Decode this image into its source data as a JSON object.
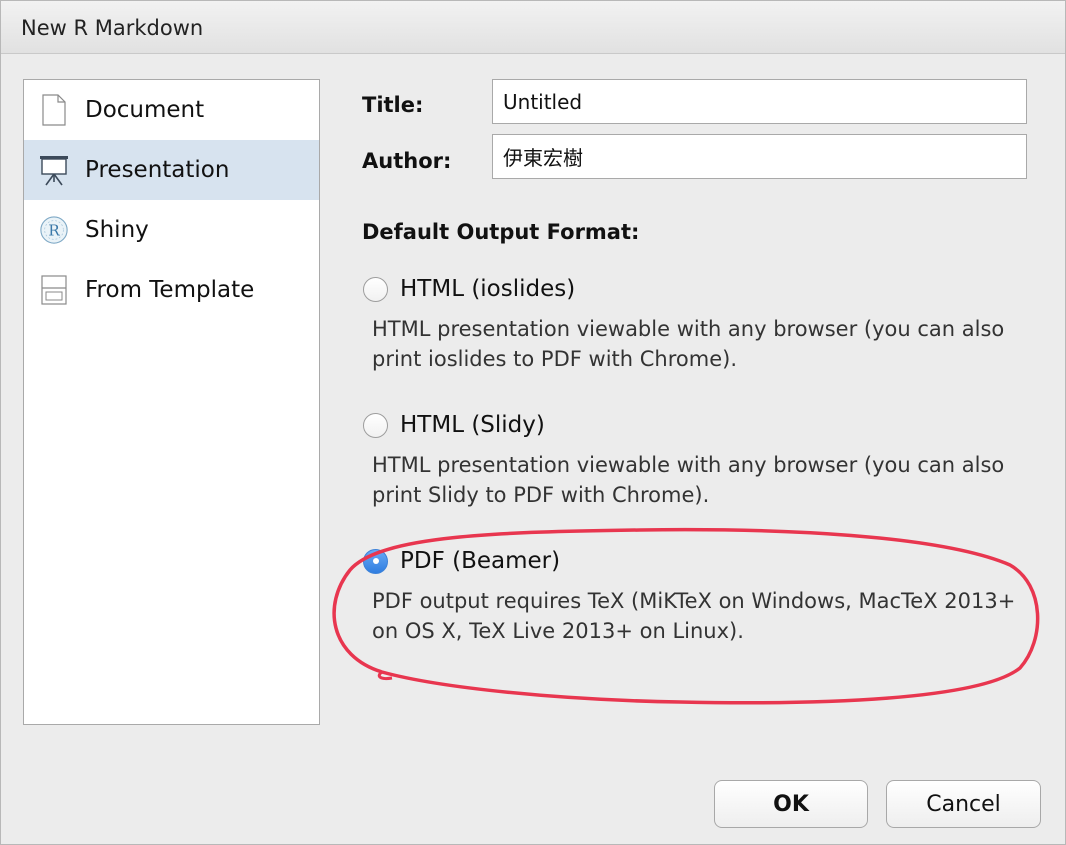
{
  "window": {
    "title": "New R Markdown"
  },
  "sidebar": {
    "items": [
      {
        "label": "Document",
        "icon": "document-icon"
      },
      {
        "label": "Presentation",
        "icon": "presentation-icon",
        "selected": true
      },
      {
        "label": "Shiny",
        "icon": "shiny-r-icon"
      },
      {
        "label": "From Template",
        "icon": "template-icon"
      }
    ]
  },
  "form": {
    "title_label": "Title:",
    "title_value": "Untitled",
    "author_label": "Author:",
    "author_value": "伊東宏樹"
  },
  "output": {
    "heading": "Default Output Format:",
    "options": [
      {
        "label": "HTML (ioslides)",
        "description": "HTML presentation viewable with any browser (you can also print ioslides to PDF with Chrome).",
        "checked": false
      },
      {
        "label": "HTML (Slidy)",
        "description": "HTML presentation viewable with any browser (you can also print Slidy to PDF with Chrome).",
        "checked": false
      },
      {
        "label": "PDF (Beamer)",
        "description": "PDF output requires TeX (MiKTeX on Windows, MacTeX 2013+ on OS X, TeX Live 2013+ on Linux).",
        "checked": true
      }
    ]
  },
  "buttons": {
    "ok": "OK",
    "cancel": "Cancel"
  },
  "colors": {
    "selection": "#d7e3ef",
    "radio_checked": "#3c82d9",
    "annotation": "#e8364f"
  }
}
